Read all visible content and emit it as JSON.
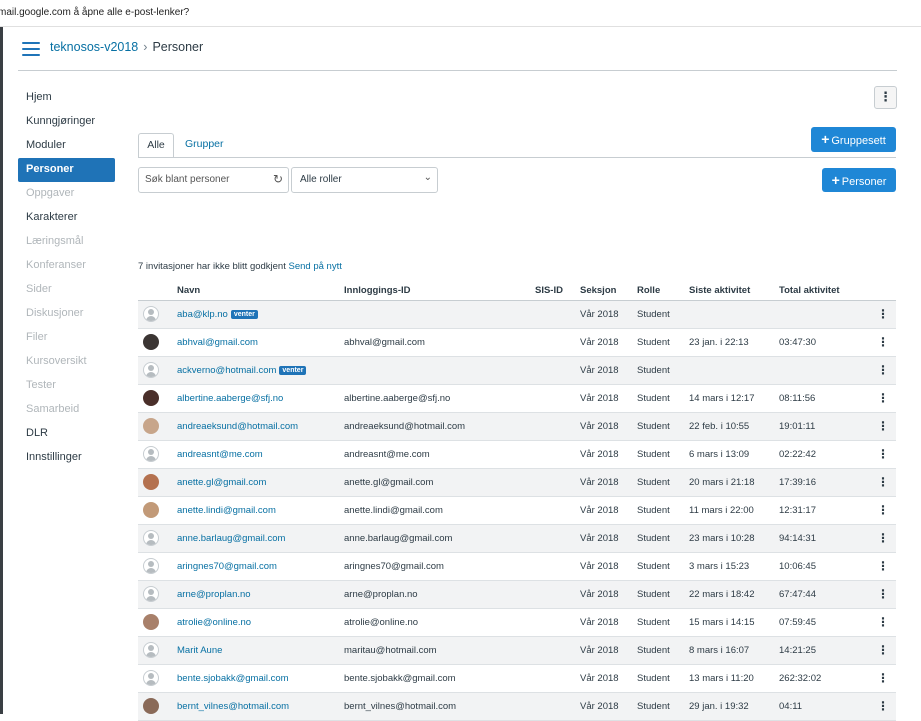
{
  "browser": {
    "status_text": "mail.google.com å åpne alle e-post-lenker?"
  },
  "header": {
    "course": "teknosos-v2018",
    "separator": "›",
    "current": "Personer"
  },
  "nav": [
    {
      "label": "Hjem",
      "state": "normal"
    },
    {
      "label": "Kunngjøringer",
      "state": "normal"
    },
    {
      "label": "Moduler",
      "state": "normal"
    },
    {
      "label": "Personer",
      "state": "active"
    },
    {
      "label": "Oppgaver",
      "state": "dim"
    },
    {
      "label": "Karakterer",
      "state": "normal"
    },
    {
      "label": "Læringsmål",
      "state": "dim"
    },
    {
      "label": "Konferanser",
      "state": "dim"
    },
    {
      "label": "Sider",
      "state": "dim"
    },
    {
      "label": "Diskusjoner",
      "state": "dim"
    },
    {
      "label": "Filer",
      "state": "dim"
    },
    {
      "label": "Kursoversikt",
      "state": "dim"
    },
    {
      "label": "Tester",
      "state": "dim"
    },
    {
      "label": "Samarbeid",
      "state": "dim"
    },
    {
      "label": "DLR",
      "state": "normal"
    },
    {
      "label": "Innstillinger",
      "state": "normal"
    }
  ],
  "tabs": {
    "all": "Alle",
    "groups": "Grupper"
  },
  "buttons": {
    "groupset": "Gruppesett",
    "people": "Personer",
    "plus": "+",
    "kebab": "⋮"
  },
  "search": {
    "placeholder": "Søk blant personer"
  },
  "role_filter": {
    "selected": "Alle roller"
  },
  "invites": {
    "text": "7 invitasjoner har ikke blitt godkjent",
    "resend": "Send på nytt"
  },
  "table": {
    "headers": {
      "name": "Navn",
      "login": "Innloggings-ID",
      "sis": "SIS-ID",
      "section": "Seksjon",
      "role": "Rolle",
      "last": "Siste aktivitet",
      "total": "Total aktivitet"
    },
    "badge": "venter",
    "rows": [
      {
        "name": "aba@klp.no",
        "pending": true,
        "login": "",
        "section": "Vår 2018",
        "role": "Student",
        "last": "",
        "total": "",
        "avatar": "generic"
      },
      {
        "name": "abhval@gmail.com",
        "pending": false,
        "login": "abhval@gmail.com",
        "section": "Vår 2018",
        "role": "Student",
        "last": "23 jan. i 22:13",
        "total": "03:47:30",
        "avatar": "photo",
        "avatar_color": "#3b3533"
      },
      {
        "name": "ackverno@hotmail.com",
        "pending": true,
        "login": "",
        "section": "Vår 2018",
        "role": "Student",
        "last": "",
        "total": "",
        "avatar": "generic"
      },
      {
        "name": "albertine.aaberge@sfj.no",
        "pending": false,
        "login": "albertine.aaberge@sfj.no",
        "section": "Vår 2018",
        "role": "Student",
        "last": "14 mars i 12:17",
        "total": "08:11:56",
        "avatar": "photo",
        "avatar_color": "#4a2f2a"
      },
      {
        "name": "andreaeksund@hotmail.com",
        "pending": false,
        "login": "andreaeksund@hotmail.com",
        "section": "Vår 2018",
        "role": "Student",
        "last": "22 feb. i 10:55",
        "total": "19:01:11",
        "avatar": "photo",
        "avatar_color": "#c7a58a"
      },
      {
        "name": "andreasnt@me.com",
        "pending": false,
        "login": "andreasnt@me.com",
        "section": "Vår 2018",
        "role": "Student",
        "last": "6 mars i 13:09",
        "total": "02:22:42",
        "avatar": "generic"
      },
      {
        "name": "anette.gl@gmail.com",
        "pending": false,
        "login": "anette.gl@gmail.com",
        "section": "Vår 2018",
        "role": "Student",
        "last": "20 mars i 21:18",
        "total": "17:39:16",
        "avatar": "photo",
        "avatar_color": "#b4714f"
      },
      {
        "name": "anette.lindi@gmail.com",
        "pending": false,
        "login": "anette.lindi@gmail.com",
        "section": "Vår 2018",
        "role": "Student",
        "last": "11 mars i 22:00",
        "total": "12:31:17",
        "avatar": "photo",
        "avatar_color": "#c29a78"
      },
      {
        "name": "anne.barlaug@gmail.com",
        "pending": false,
        "login": "anne.barlaug@gmail.com",
        "section": "Vår 2018",
        "role": "Student",
        "last": "23 mars i 10:28",
        "total": "94:14:31",
        "avatar": "generic"
      },
      {
        "name": "aringnes70@gmail.com",
        "pending": false,
        "login": "aringnes70@gmail.com",
        "section": "Vår 2018",
        "role": "Student",
        "last": "3 mars i 15:23",
        "total": "10:06:45",
        "avatar": "generic"
      },
      {
        "name": "arne@proplan.no",
        "pending": false,
        "login": "arne@proplan.no",
        "section": "Vår 2018",
        "role": "Student",
        "last": "22 mars i 18:42",
        "total": "67:47:44",
        "avatar": "generic"
      },
      {
        "name": "atrolie@online.no",
        "pending": false,
        "login": "atrolie@online.no",
        "section": "Vår 2018",
        "role": "Student",
        "last": "15 mars i 14:15",
        "total": "07:59:45",
        "avatar": "photo",
        "avatar_color": "#a8806a"
      },
      {
        "name": "Marit Aune",
        "pending": false,
        "login": "maritau@hotmail.com",
        "section": "Vår 2018",
        "role": "Student",
        "last": "8 mars i 16:07",
        "total": "14:21:25",
        "avatar": "generic"
      },
      {
        "name": "bente.sjobakk@gmail.com",
        "pending": false,
        "login": "bente.sjobakk@gmail.com",
        "section": "Vår 2018",
        "role": "Student",
        "last": "13 mars i 11:20",
        "total": "262:32:02",
        "avatar": "generic"
      },
      {
        "name": "bernt_vilnes@hotmail.com",
        "pending": false,
        "login": "bernt_vilnes@hotmail.com",
        "section": "Vår 2018",
        "role": "Student",
        "last": "29 jan. i 19:32",
        "total": "04:11",
        "avatar": "photo",
        "avatar_color": "#8a6a58"
      }
    ]
  }
}
